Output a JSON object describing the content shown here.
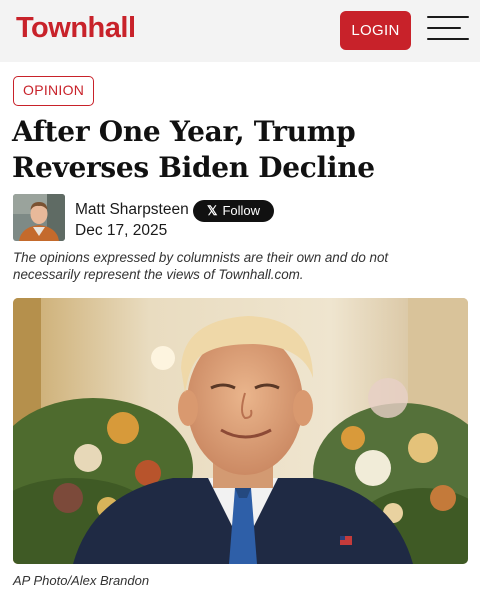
{
  "header": {
    "logo_text": "Townhall",
    "login_label": "LOGIN",
    "menu_icon": "hamburger-menu-icon",
    "brand_color": "#c8222a"
  },
  "article": {
    "section_badge": "OPINION",
    "headline": "After One Year, Trump Reverses Biden Decline",
    "author": "Matt Sharpsteen",
    "follow_label": "Follow",
    "follow_icon": "x-logo-icon",
    "date": "Dec 17, 2025",
    "disclaimer": "The opinions expressed by columnists are their own and do not necessarily represent the views of Townhall.com.",
    "photo_caption": "AP Photo/Alex Brandon"
  }
}
